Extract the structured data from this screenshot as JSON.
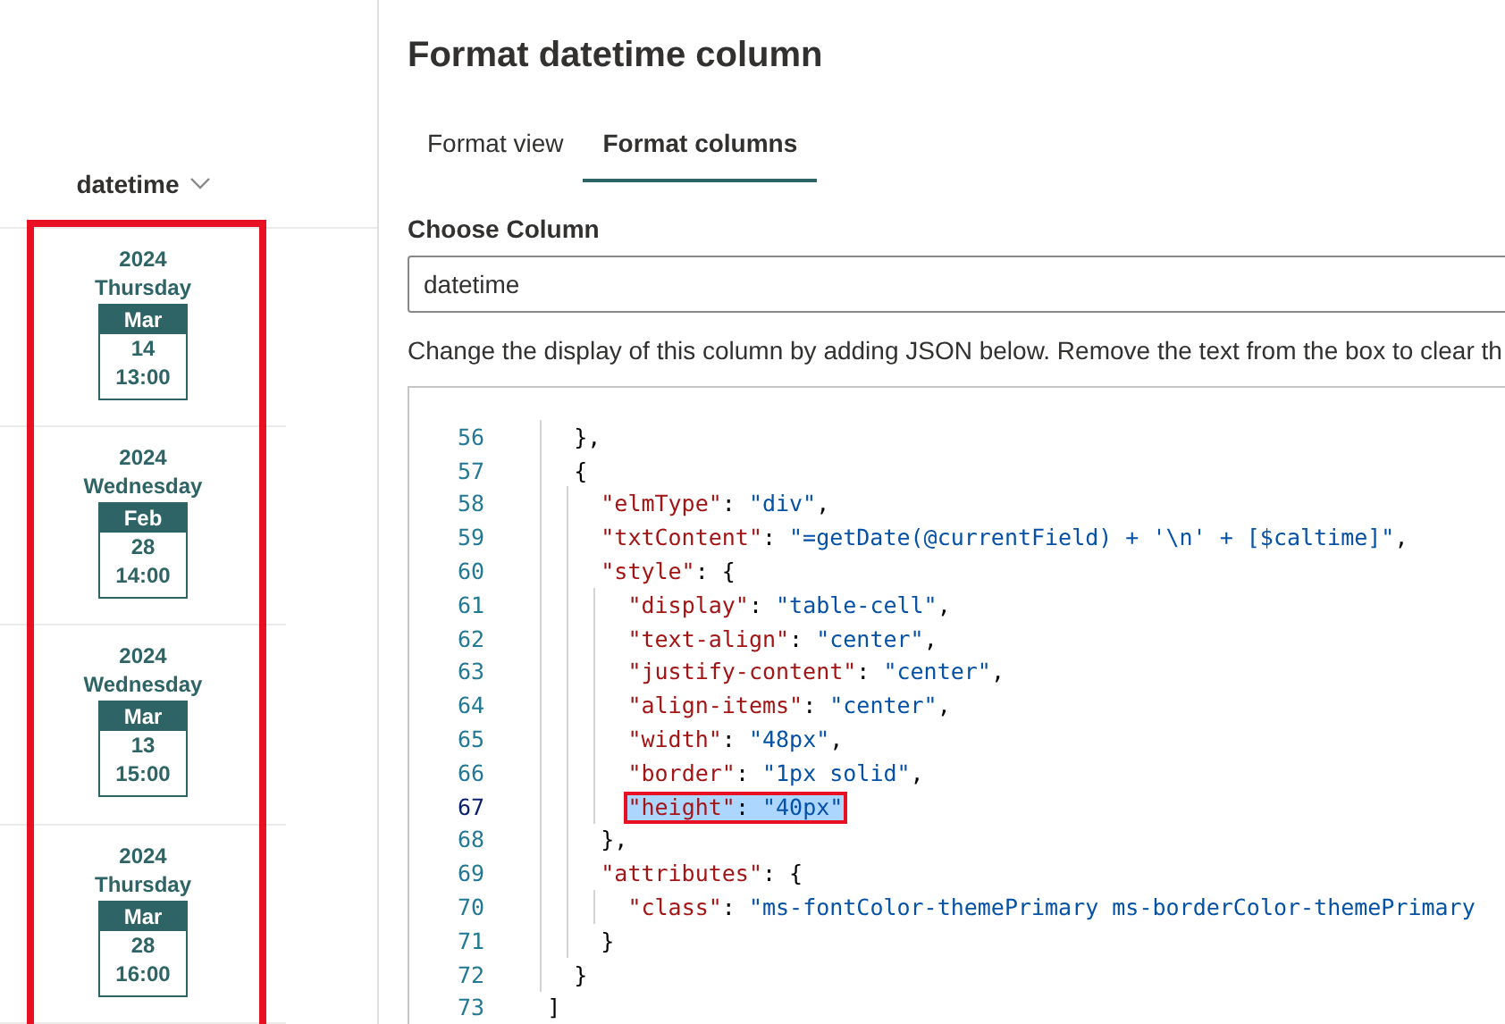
{
  "list": {
    "column": {
      "label": "datetime"
    },
    "highlighted": true,
    "rows": [
      {
        "year": "2024",
        "weekday": "Thursday",
        "month": "Mar",
        "day": "14",
        "time": "13:00"
      },
      {
        "year": "2024",
        "weekday": "Wednesday",
        "month": "Feb",
        "day": "28",
        "time": "14:00"
      },
      {
        "year": "2024",
        "weekday": "Wednesday",
        "month": "Mar",
        "day": "13",
        "time": "15:00"
      },
      {
        "year": "2024",
        "weekday": "Thursday",
        "month": "Mar",
        "day": "28",
        "time": "16:00"
      }
    ]
  },
  "panel": {
    "title": "Format datetime column",
    "tabs": [
      {
        "label": "Format view",
        "selected": false
      },
      {
        "label": "Format columns",
        "selected": true
      }
    ],
    "choose_column": {
      "label": "Choose Column",
      "value": "datetime"
    },
    "description": "Change the display of this column by adding JSON below. Remove the text from the box to clear th",
    "editor": {
      "lines": [
        {
          "number": "56",
          "selected": false,
          "highlighted": false,
          "tokens": [
            {
              "kind": "punct",
              "text": "    },"
            }
          ]
        },
        {
          "number": "57",
          "selected": false,
          "highlighted": false,
          "tokens": [
            {
              "kind": "punct",
              "text": "    {"
            }
          ]
        },
        {
          "number": "58",
          "selected": false,
          "highlighted": false,
          "tokens": [
            {
              "kind": "key",
              "text": "      \"elmType\""
            },
            {
              "kind": "punct",
              "text": ": "
            },
            {
              "kind": "string",
              "text": "\"div\""
            },
            {
              "kind": "punct",
              "text": ","
            }
          ]
        },
        {
          "number": "59",
          "selected": false,
          "highlighted": false,
          "tokens": [
            {
              "kind": "key",
              "text": "      \"txtContent\""
            },
            {
              "kind": "punct",
              "text": ": "
            },
            {
              "kind": "string",
              "text": "\"=getDate(@currentField) + '\\n' + [$caltime]\""
            },
            {
              "kind": "punct",
              "text": ","
            }
          ]
        },
        {
          "number": "60",
          "selected": false,
          "highlighted": false,
          "tokens": [
            {
              "kind": "key",
              "text": "      \"style\""
            },
            {
              "kind": "punct",
              "text": ": {"
            }
          ]
        },
        {
          "number": "61",
          "selected": false,
          "highlighted": false,
          "tokens": [
            {
              "kind": "key",
              "text": "        \"display\""
            },
            {
              "kind": "punct",
              "text": ": "
            },
            {
              "kind": "string",
              "text": "\"table-cell\""
            },
            {
              "kind": "punct",
              "text": ","
            }
          ]
        },
        {
          "number": "62",
          "selected": false,
          "highlighted": false,
          "tokens": [
            {
              "kind": "key",
              "text": "        \"text-align\""
            },
            {
              "kind": "punct",
              "text": ": "
            },
            {
              "kind": "string",
              "text": "\"center\""
            },
            {
              "kind": "punct",
              "text": ","
            }
          ]
        },
        {
          "number": "63",
          "selected": false,
          "highlighted": false,
          "tokens": [
            {
              "kind": "key",
              "text": "        \"justify-content\""
            },
            {
              "kind": "punct",
              "text": ": "
            },
            {
              "kind": "string",
              "text": "\"center\""
            },
            {
              "kind": "punct",
              "text": ","
            }
          ]
        },
        {
          "number": "64",
          "selected": false,
          "highlighted": false,
          "tokens": [
            {
              "kind": "key",
              "text": "        \"align-items\""
            },
            {
              "kind": "punct",
              "text": ": "
            },
            {
              "kind": "string",
              "text": "\"center\""
            },
            {
              "kind": "punct",
              "text": ","
            }
          ]
        },
        {
          "number": "65",
          "selected": false,
          "highlighted": false,
          "tokens": [
            {
              "kind": "key",
              "text": "        \"width\""
            },
            {
              "kind": "punct",
              "text": ": "
            },
            {
              "kind": "string",
              "text": "\"48px\""
            },
            {
              "kind": "punct",
              "text": ","
            }
          ]
        },
        {
          "number": "66",
          "selected": false,
          "highlighted": false,
          "tokens": [
            {
              "kind": "key",
              "text": "        \"border\""
            },
            {
              "kind": "punct",
              "text": ": "
            },
            {
              "kind": "string",
              "text": "\"1px solid\""
            },
            {
              "kind": "punct",
              "text": ","
            }
          ]
        },
        {
          "number": "67",
          "selected": true,
          "highlighted": true,
          "tokens": [
            {
              "kind": "key",
              "text": "        \"height\""
            },
            {
              "kind": "punct",
              "text": ": "
            },
            {
              "kind": "string",
              "text": "\"40px\""
            }
          ]
        },
        {
          "number": "68",
          "selected": false,
          "highlighted": false,
          "tokens": [
            {
              "kind": "punct",
              "text": "      },"
            }
          ]
        },
        {
          "number": "69",
          "selected": false,
          "highlighted": false,
          "tokens": [
            {
              "kind": "key",
              "text": "      \"attributes\""
            },
            {
              "kind": "punct",
              "text": ": {"
            }
          ]
        },
        {
          "number": "70",
          "selected": false,
          "highlighted": false,
          "tokens": [
            {
              "kind": "key",
              "text": "        \"class\""
            },
            {
              "kind": "punct",
              "text": ": "
            },
            {
              "kind": "string",
              "text": "\"ms-fontColor-themePrimary ms-borderColor-themePrimary"
            }
          ]
        },
        {
          "number": "71",
          "selected": false,
          "highlighted": false,
          "tokens": [
            {
              "kind": "punct",
              "text": "      }"
            }
          ]
        },
        {
          "number": "72",
          "selected": false,
          "highlighted": false,
          "tokens": [
            {
              "kind": "punct",
              "text": "    }"
            }
          ]
        },
        {
          "number": "73",
          "selected": false,
          "highlighted": false,
          "tokens": [
            {
              "kind": "punct",
              "text": "  ]"
            }
          ]
        }
      ]
    }
  }
}
